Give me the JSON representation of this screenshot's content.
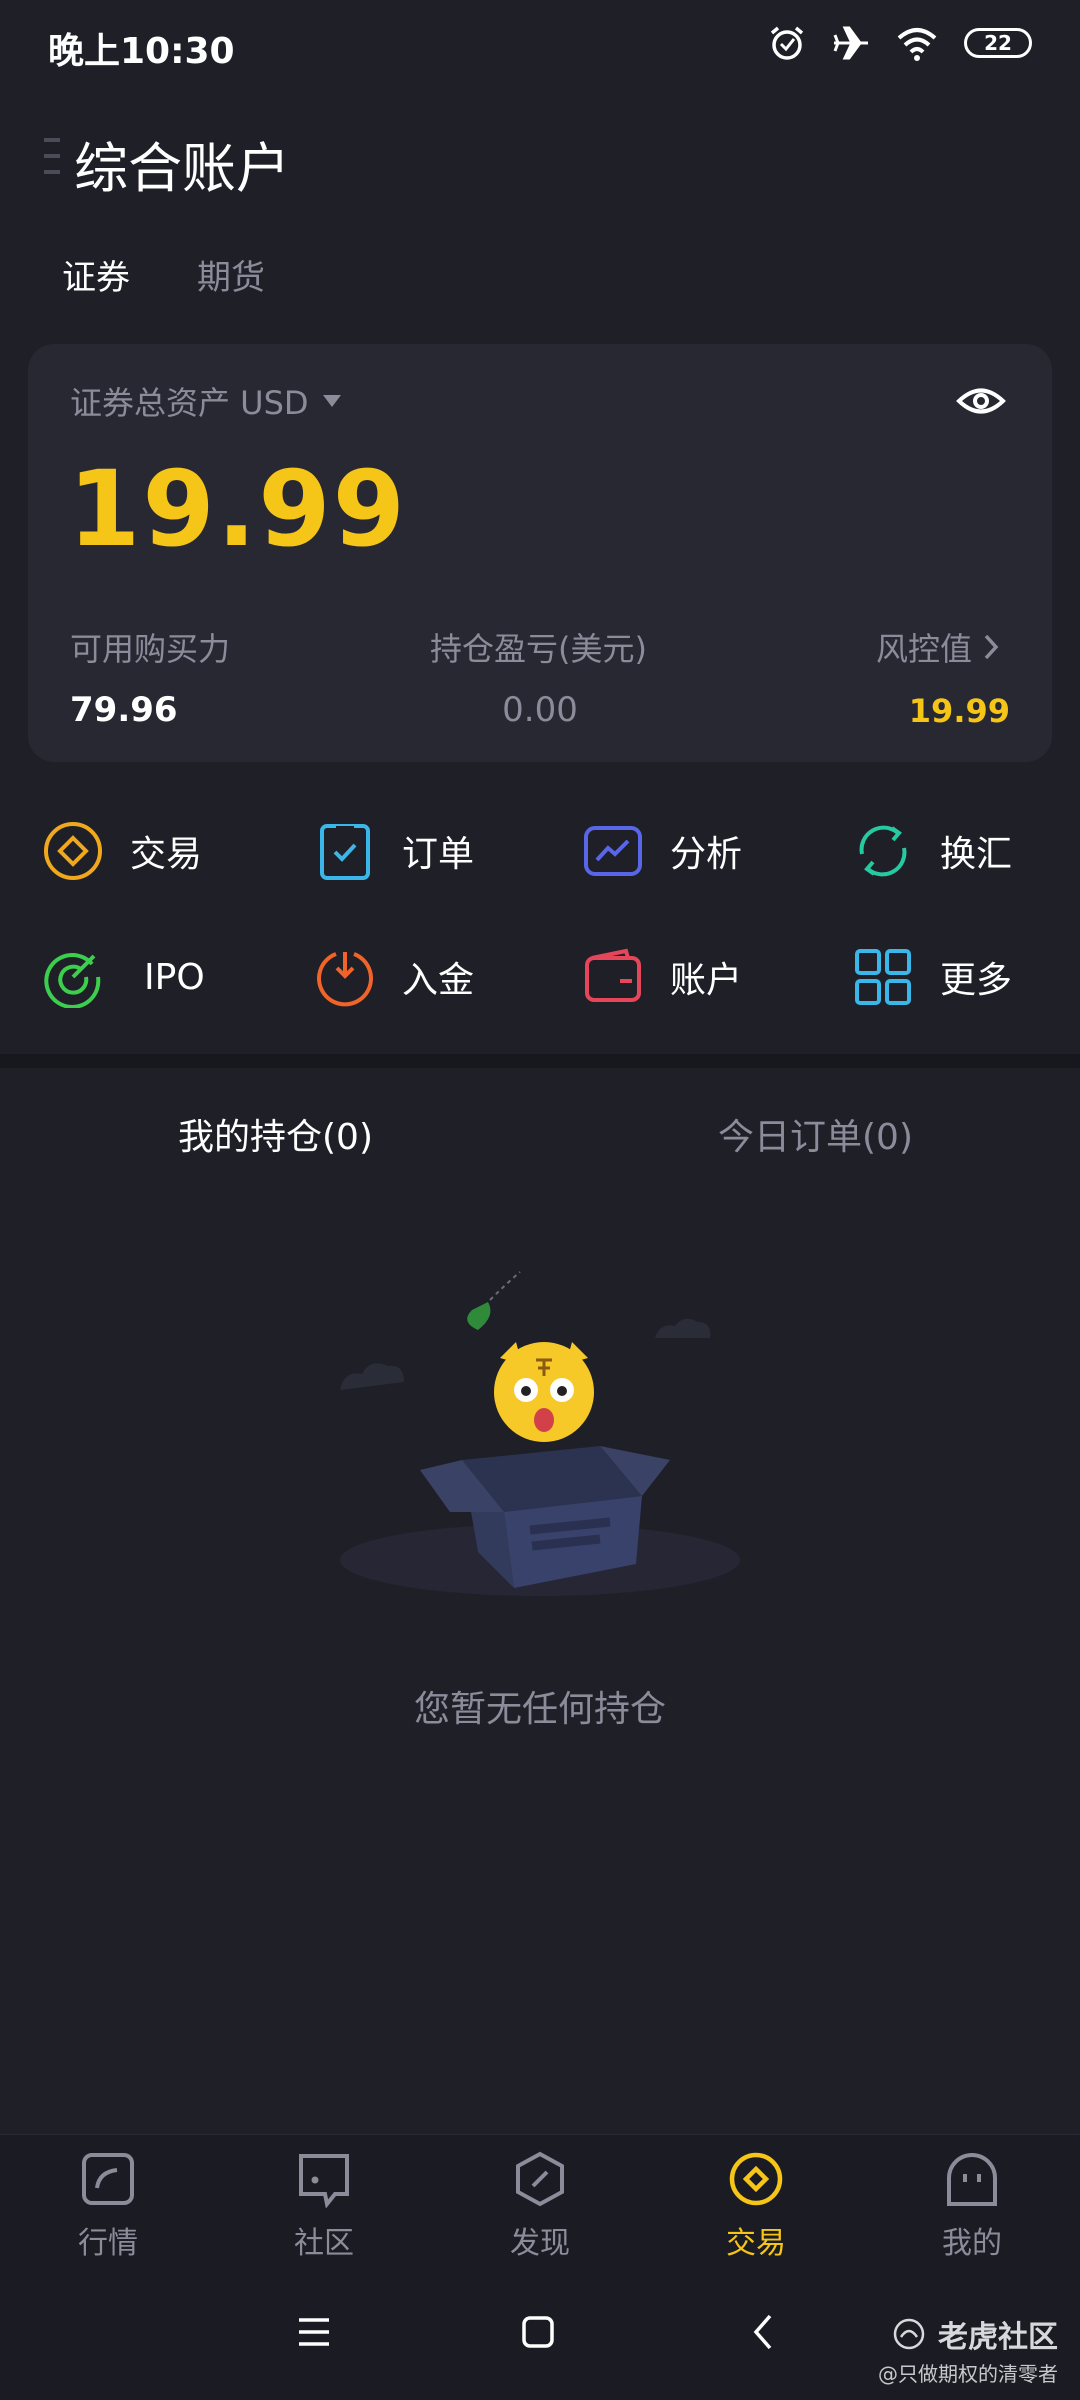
{
  "status_bar": {
    "time": "晚上10:30",
    "battery": "22"
  },
  "header": {
    "title": "综合账户"
  },
  "tabs": [
    {
      "label": "证券"
    },
    {
      "label": "期货"
    }
  ],
  "asset_card": {
    "label": "证券总资产 USD",
    "value": "19.99",
    "buying_power_label": "可用购买力",
    "buying_power_value": "79.96",
    "pnl_label": "持仓盈亏(美元)",
    "pnl_value": "0.00",
    "risk_label": "风控值",
    "risk_value": "19.99"
  },
  "quick_actions": [
    {
      "label": "交易",
      "icon": "diamond-coin-icon",
      "color": "#f0a81c"
    },
    {
      "label": "订单",
      "icon": "order-check-icon",
      "color": "#3ab6e8"
    },
    {
      "label": "分析",
      "icon": "analysis-chart-icon",
      "color": "#5a66e8"
    },
    {
      "label": "换汇",
      "icon": "exchange-icon",
      "color": "#27c9a0"
    },
    {
      "label": "IPO",
      "icon": "ipo-target-icon",
      "color": "#3ccf4e"
    },
    {
      "label": "入金",
      "icon": "deposit-icon",
      "color": "#f0642a"
    },
    {
      "label": "账户",
      "icon": "wallet-icon",
      "color": "#e6465a"
    },
    {
      "label": "更多",
      "icon": "grid-more-icon",
      "color": "#3ab6e8"
    }
  ],
  "holdings": {
    "tab_holdings": "我的持仓(0)",
    "tab_orders": "今日订单(0)",
    "empty_text": "您暂无任何持仓"
  },
  "bottom_nav": [
    {
      "label": "行情",
      "icon": "market-icon",
      "active": false
    },
    {
      "label": "社区",
      "icon": "community-icon",
      "active": false
    },
    {
      "label": "发现",
      "icon": "discover-icon",
      "active": false
    },
    {
      "label": "交易",
      "icon": "trade-icon",
      "active": true
    },
    {
      "label": "我的",
      "icon": "profile-icon",
      "active": false
    }
  ],
  "watermark": {
    "brand": "老虎社区",
    "author": "@只做期权的清零者"
  },
  "colors": {
    "accent": "#f5c518",
    "background": "#1f1f28",
    "card": "#282833",
    "muted": "#8a8c9a"
  }
}
